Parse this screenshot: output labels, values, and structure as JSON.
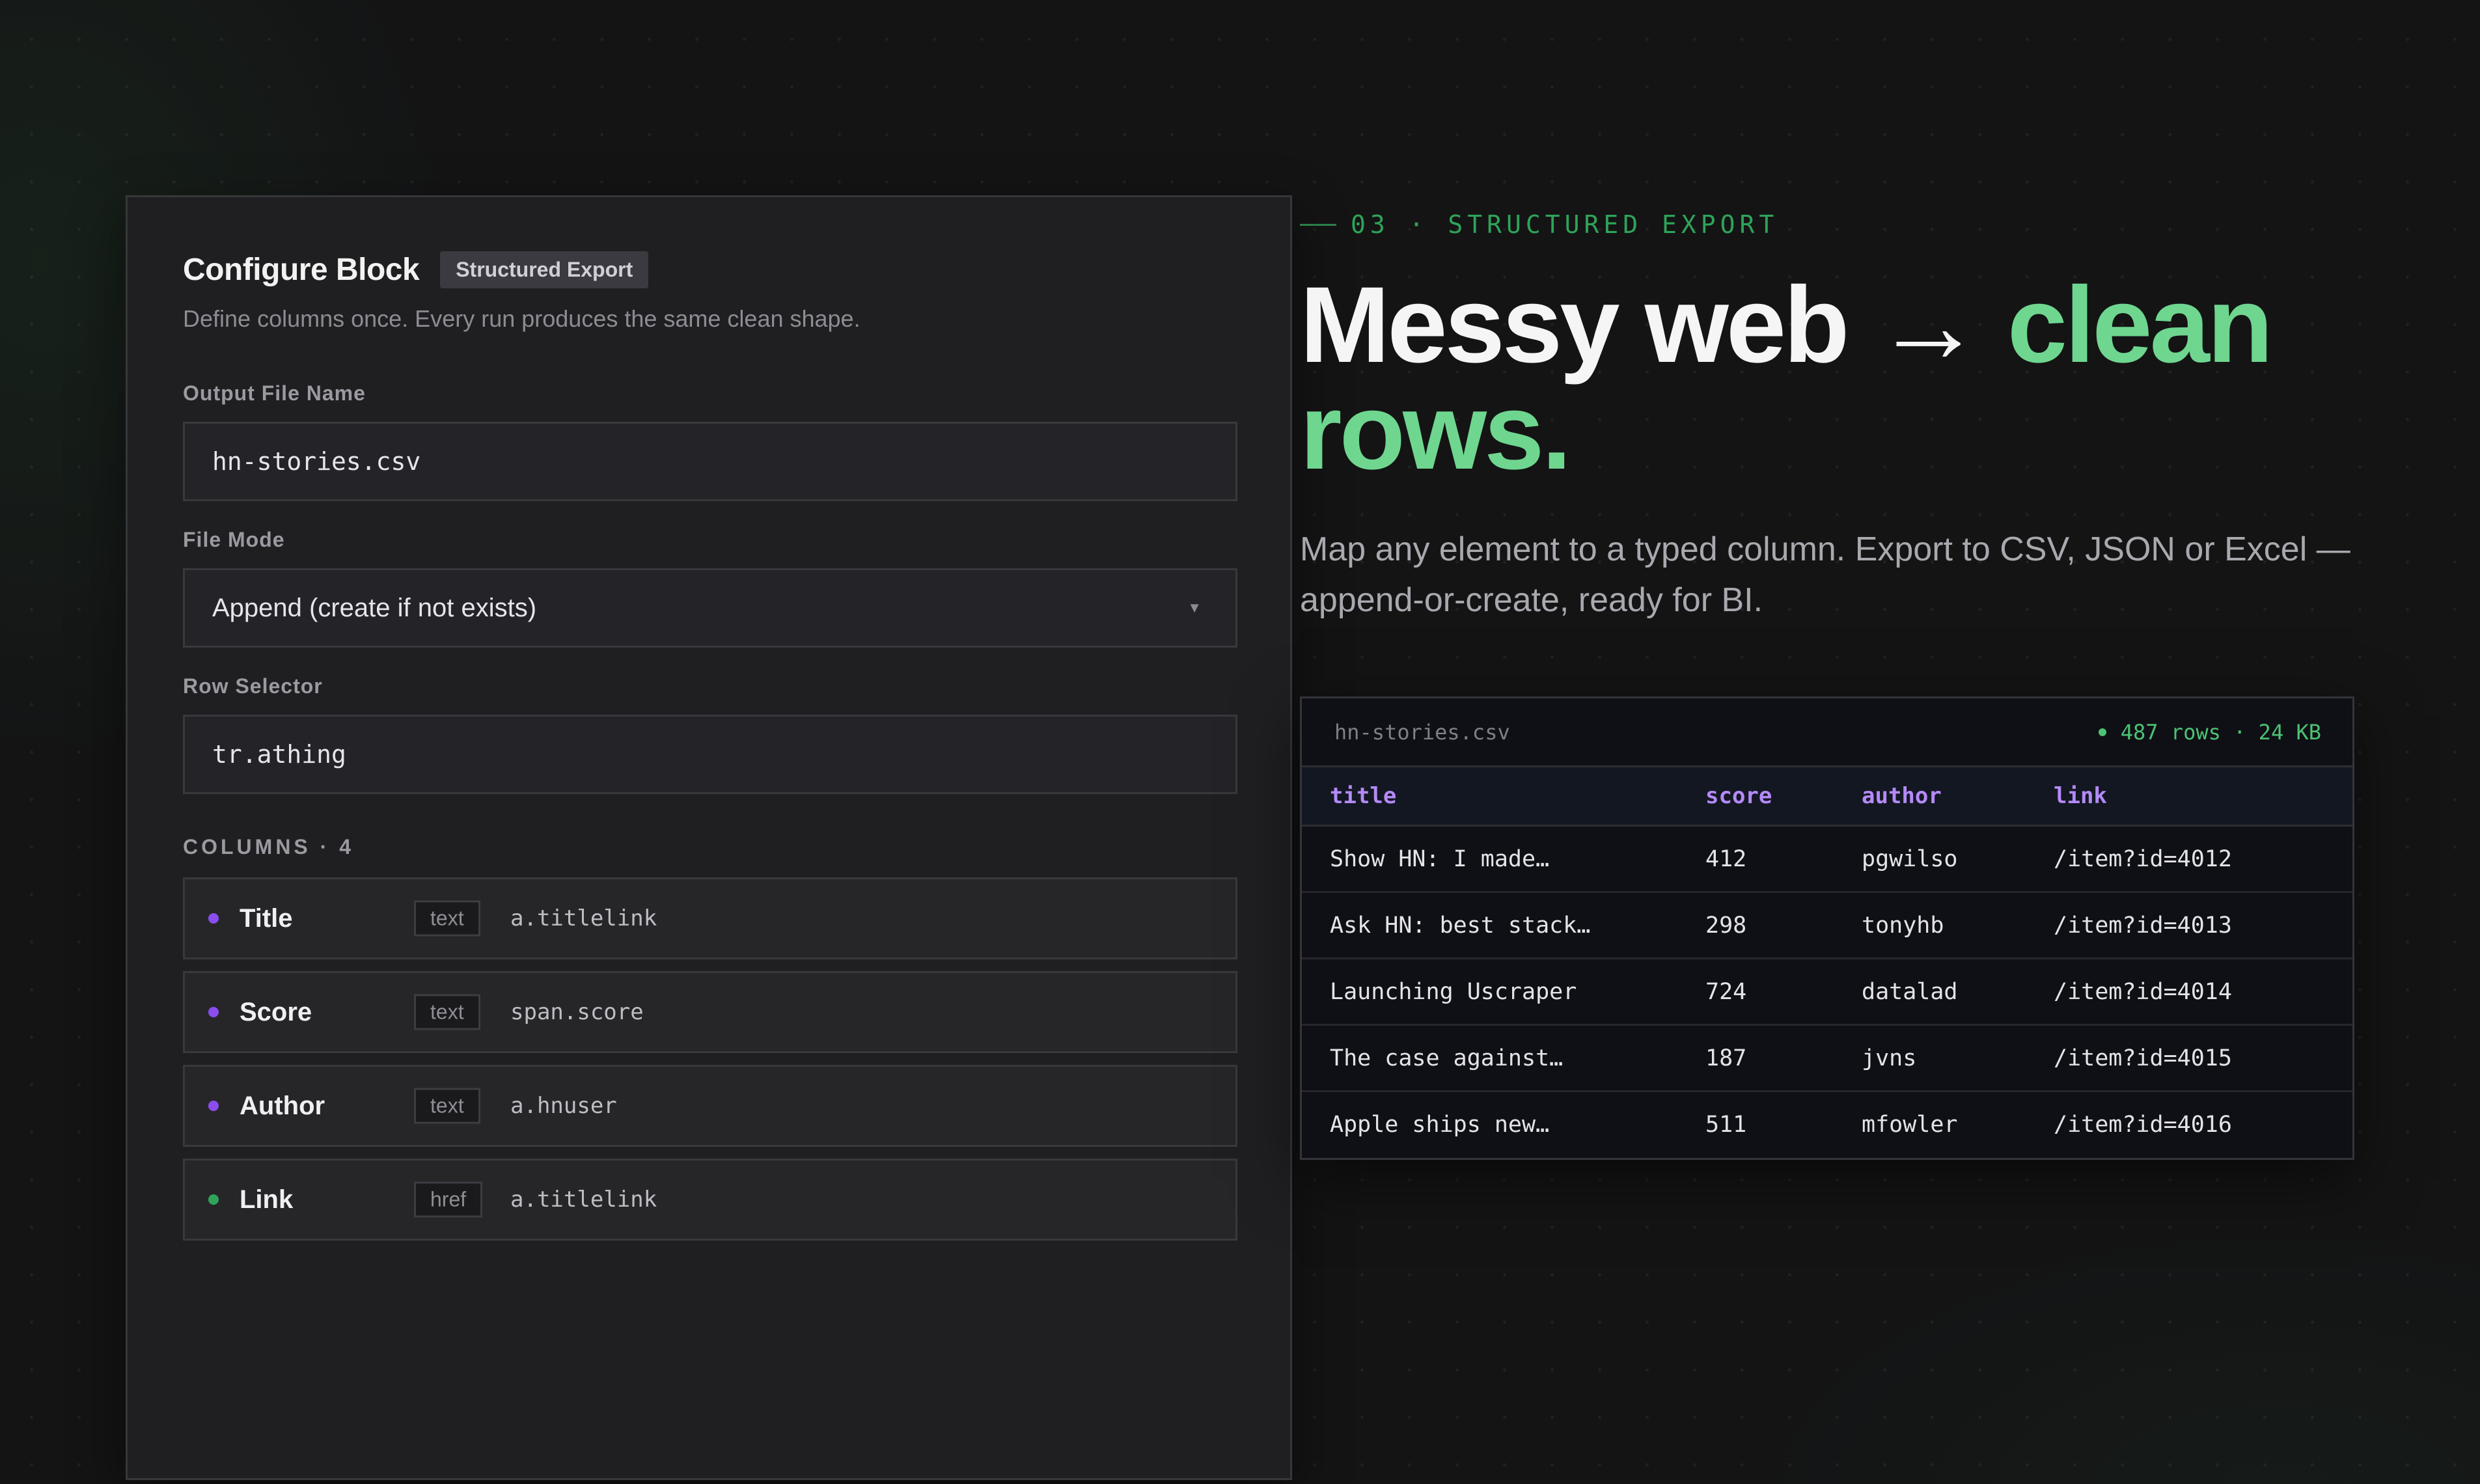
{
  "config": {
    "title": "Configure Block",
    "badge": "Structured Export",
    "subtitle": "Define columns once. Every run produces the same clean shape.",
    "output_label": "Output File Name",
    "output_value": "hn-stories.csv",
    "mode_label": "File Mode",
    "mode_value": "Append (create if not exists)",
    "row_label": "Row Selector",
    "row_value": "tr.athing",
    "columns_label": "COLUMNS · 4",
    "columns": [
      {
        "name": "Title",
        "type": "text",
        "selector": "a.titlelink",
        "dot_color": "#8b4cf0"
      },
      {
        "name": "Score",
        "type": "text",
        "selector": "span.score",
        "dot_color": "#8b4cf0"
      },
      {
        "name": "Author",
        "type": "text",
        "selector": "a.hnuser",
        "dot_color": "#8b4cf0"
      },
      {
        "name": "Link",
        "type": "href",
        "selector": "a.titlelink",
        "dot_color": "#2fa35a"
      }
    ]
  },
  "hero": {
    "eyebrow": "03 · STRUCTURED EXPORT",
    "headline_plain": "Messy web → ",
    "headline_accent": "clean rows.",
    "lede": "Map any element to a typed column. Export to CSV, JSON or Excel — append-or-create, ready for BI."
  },
  "preview": {
    "file": "hn-stories.csv",
    "stats": "487 rows · 24 KB",
    "headers": [
      "title",
      "score",
      "author",
      "link"
    ],
    "rows": [
      [
        "Show HN: I made…",
        "412",
        "pgwilso",
        "/item?id=4012"
      ],
      [
        "Ask HN: best stack…",
        "298",
        "tonyhb",
        "/item?id=4013"
      ],
      [
        "Launching Uscraper",
        "724",
        "datalad",
        "/item?id=4014"
      ],
      [
        "The case against…",
        "187",
        "jvns",
        "/item?id=4015"
      ],
      [
        "Apple ships new…",
        "511",
        "mfowler",
        "/item?id=4016"
      ]
    ]
  },
  "colors": {
    "accent_green": "#6fd68f",
    "header_purple": "#b48af7",
    "panel_bg": "#1f1f22",
    "page_bg": "#141415"
  }
}
